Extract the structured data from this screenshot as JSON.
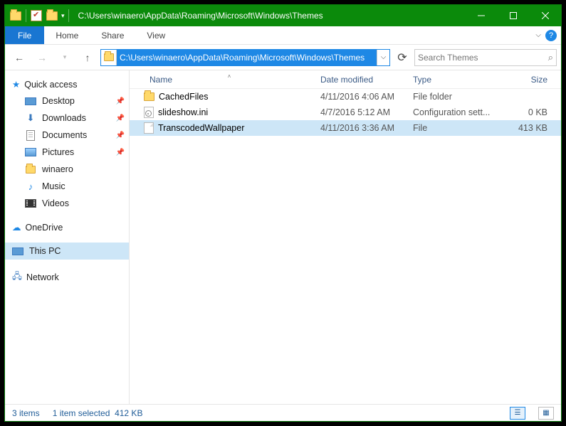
{
  "titlebar": {
    "path": "C:\\Users\\winaero\\AppData\\Roaming\\Microsoft\\Windows\\Themes"
  },
  "ribbon": {
    "file": "File",
    "home": "Home",
    "share": "Share",
    "view": "View"
  },
  "address": {
    "path": "C:\\Users\\winaero\\AppData\\Roaming\\Microsoft\\Windows\\Themes"
  },
  "search": {
    "placeholder": "Search Themes"
  },
  "sidebar": {
    "quick_access": "Quick access",
    "items": [
      {
        "label": "Desktop"
      },
      {
        "label": "Downloads"
      },
      {
        "label": "Documents"
      },
      {
        "label": "Pictures"
      },
      {
        "label": "winaero"
      },
      {
        "label": "Music"
      },
      {
        "label": "Videos"
      }
    ],
    "onedrive": "OneDrive",
    "thispc": "This PC",
    "network": "Network"
  },
  "columns": {
    "name": "Name",
    "date": "Date modified",
    "type": "Type",
    "size": "Size"
  },
  "files": [
    {
      "name": "CachedFiles",
      "date": "4/11/2016 4:06 AM",
      "type": "File folder",
      "size": ""
    },
    {
      "name": "slideshow.ini",
      "date": "4/7/2016 5:12 AM",
      "type": "Configuration sett...",
      "size": "0 KB"
    },
    {
      "name": "TranscodedWallpaper",
      "date": "4/11/2016 3:36 AM",
      "type": "File",
      "size": "413 KB"
    }
  ],
  "status": {
    "count": "3 items",
    "selected": "1 item selected",
    "size": "412 KB"
  }
}
